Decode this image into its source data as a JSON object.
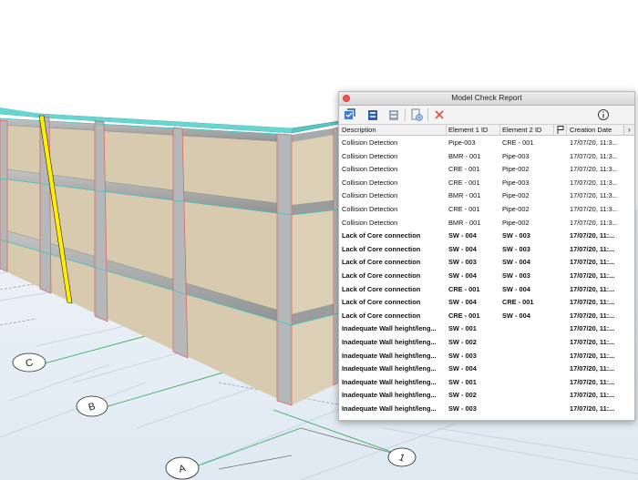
{
  "window": {
    "title": "Model Check Report"
  },
  "toolbar": {
    "buttons": [
      {
        "name": "run-check-icon",
        "interactable": true
      },
      {
        "name": "select-elements-icon",
        "interactable": true
      },
      {
        "name": "show-elements-icon",
        "interactable": true
      },
      {
        "name": "export-report-icon",
        "interactable": true
      },
      {
        "name": "delete-icon",
        "interactable": true
      }
    ],
    "info_label": "i"
  },
  "table": {
    "columns": [
      "Description",
      "Element 1 ID",
      "Element 2 ID",
      "",
      "Creation Date"
    ],
    "flag_icon": "flag-icon",
    "rows": [
      {
        "description": "Collision Detection",
        "element1": "Pipe-003",
        "element2": "CRE - 001",
        "date": "17/07/20, 11:3...",
        "bold": false
      },
      {
        "description": "Collision Detection",
        "element1": "BMR - 001",
        "element2": "Pipe-003",
        "date": "17/07/20, 11:3...",
        "bold": false
      },
      {
        "description": "Collision Detection",
        "element1": "CRE - 001",
        "element2": "Pipe-002",
        "date": "17/07/20, 11:3...",
        "bold": false
      },
      {
        "description": "Collision Detection",
        "element1": "CRE - 001",
        "element2": "Pipe-003",
        "date": "17/07/20, 11:3...",
        "bold": false
      },
      {
        "description": "Collision Detection",
        "element1": "BMR - 001",
        "element2": "Pipe-002",
        "date": "17/07/20, 11:3...",
        "bold": false
      },
      {
        "description": "Collision Detection",
        "element1": "CRE - 001",
        "element2": "Pipe-002",
        "date": "17/07/20, 11:3...",
        "bold": false
      },
      {
        "description": "Collision Detection",
        "element1": "BMR - 001",
        "element2": "Pipe-002",
        "date": "17/07/20, 11:3...",
        "bold": false
      },
      {
        "description": "Lack of Core connection",
        "element1": "SW - 004",
        "element2": "SW - 003",
        "date": "17/07/20, 11:...",
        "bold": true
      },
      {
        "description": "Lack of Core connection",
        "element1": "SW - 004",
        "element2": "SW - 003",
        "date": "17/07/20, 11:...",
        "bold": true
      },
      {
        "description": "Lack of Core connection",
        "element1": "SW - 003",
        "element2": "SW - 004",
        "date": "17/07/20, 11:...",
        "bold": true
      },
      {
        "description": "Lack of Core connection",
        "element1": "SW - 004",
        "element2": "SW - 003",
        "date": "17/07/20, 11:...",
        "bold": true
      },
      {
        "description": "Lack of Core connection",
        "element1": "CRE - 001",
        "element2": "SW - 004",
        "date": "17/07/20, 11:...",
        "bold": true
      },
      {
        "description": "Lack of Core connection",
        "element1": "SW - 004",
        "element2": "CRE - 001",
        "date": "17/07/20, 11:...",
        "bold": true
      },
      {
        "description": "Lack of Core connection",
        "element1": "CRE - 001",
        "element2": "SW - 004",
        "date": "17/07/20, 11:...",
        "bold": true
      },
      {
        "description": "Inadequate Wall height/leng...",
        "element1": "SW - 001",
        "element2": "",
        "date": "17/07/20, 11:...",
        "bold": true
      },
      {
        "description": "Inadequate Wall height/leng...",
        "element1": "SW - 002",
        "element2": "",
        "date": "17/07/20, 11:...",
        "bold": true
      },
      {
        "description": "Inadequate Wall height/leng...",
        "element1": "SW - 003",
        "element2": "",
        "date": "17/07/20, 11:...",
        "bold": true
      },
      {
        "description": "Inadequate Wall height/leng...",
        "element1": "SW - 004",
        "element2": "",
        "date": "17/07/20, 11:...",
        "bold": true
      },
      {
        "description": "Inadequate Wall height/leng...",
        "element1": "SW - 001",
        "element2": "",
        "date": "17/07/20, 11:...",
        "bold": true
      },
      {
        "description": "Inadequate Wall height/leng...",
        "element1": "SW - 002",
        "element2": "",
        "date": "17/07/20, 11:...",
        "bold": true
      },
      {
        "description": "Inadequate Wall height/leng...",
        "element1": "SW - 003",
        "element2": "",
        "date": "17/07/20, 11:...",
        "bold": true
      }
    ]
  },
  "viewport": {
    "grid_labels": [
      "C",
      "B",
      "A",
      "1"
    ],
    "colors": {
      "panel_fill": "#d8ccb4",
      "frame": "#a9abab",
      "roof": "#55c8c4",
      "highlight": "#ffee00",
      "grid_floor": "#dbe7f3"
    }
  }
}
